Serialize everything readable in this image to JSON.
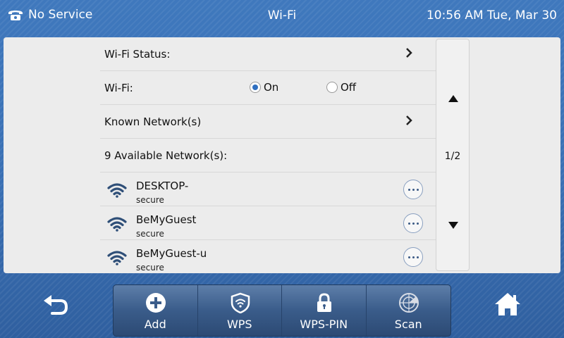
{
  "status_bar": {
    "service": "No Service",
    "title": "Wi-Fi",
    "datetime": "10:56 AM Tue, Mar 30"
  },
  "settings": {
    "wifi_status_label": "Wi-Fi Status:",
    "wifi_label": "Wi-Fi:",
    "wifi_on_label": "On",
    "wifi_off_label": "Off",
    "wifi_selected": "On",
    "known_networks_label": "Known Network(s)",
    "available_label": "9 Available Network(s):"
  },
  "networks": [
    {
      "name": "DESKTOP-",
      "security": "secure"
    },
    {
      "name": "BeMyGuest",
      "security": "secure"
    },
    {
      "name": "BeMyGuest-u",
      "security": "secure"
    }
  ],
  "pagination": {
    "indicator": "1/2"
  },
  "softkeys": [
    {
      "label": "Add",
      "icon": "plus-circle-icon"
    },
    {
      "label": "WPS",
      "icon": "shield-wifi-icon"
    },
    {
      "label": "WPS-PIN",
      "icon": "lock-icon"
    },
    {
      "label": "Scan",
      "icon": "radar-icon"
    }
  ],
  "colors": {
    "background": "#3a70b4",
    "panel": "#ececec",
    "softkey": "#3a5c8a",
    "radio_checked": "#2f6fc0"
  }
}
